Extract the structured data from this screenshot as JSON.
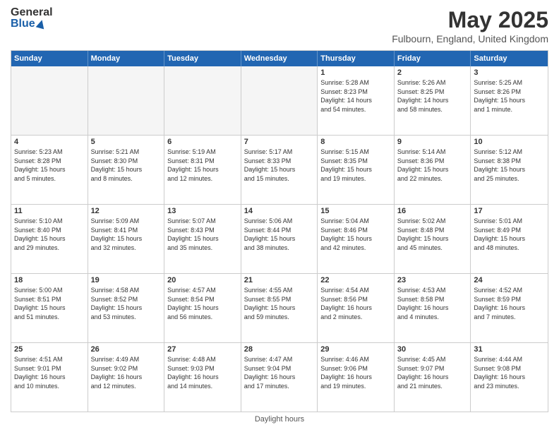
{
  "header": {
    "logo_general": "General",
    "logo_blue": "Blue",
    "title": "May 2025",
    "location": "Fulbourn, England, United Kingdom"
  },
  "days_of_week": [
    "Sunday",
    "Monday",
    "Tuesday",
    "Wednesday",
    "Thursday",
    "Friday",
    "Saturday"
  ],
  "footer": {
    "label": "Daylight hours"
  },
  "weeks": [
    {
      "cells": [
        {
          "day": "",
          "empty": true,
          "content": ""
        },
        {
          "day": "",
          "empty": true,
          "content": ""
        },
        {
          "day": "",
          "empty": true,
          "content": ""
        },
        {
          "day": "",
          "empty": true,
          "content": ""
        },
        {
          "day": "1",
          "empty": false,
          "content": "Sunrise: 5:28 AM\nSunset: 8:23 PM\nDaylight: 14 hours\nand 54 minutes."
        },
        {
          "day": "2",
          "empty": false,
          "content": "Sunrise: 5:26 AM\nSunset: 8:25 PM\nDaylight: 14 hours\nand 58 minutes."
        },
        {
          "day": "3",
          "empty": false,
          "content": "Sunrise: 5:25 AM\nSunset: 8:26 PM\nDaylight: 15 hours\nand 1 minute."
        }
      ]
    },
    {
      "cells": [
        {
          "day": "4",
          "empty": false,
          "content": "Sunrise: 5:23 AM\nSunset: 8:28 PM\nDaylight: 15 hours\nand 5 minutes."
        },
        {
          "day": "5",
          "empty": false,
          "content": "Sunrise: 5:21 AM\nSunset: 8:30 PM\nDaylight: 15 hours\nand 8 minutes."
        },
        {
          "day": "6",
          "empty": false,
          "content": "Sunrise: 5:19 AM\nSunset: 8:31 PM\nDaylight: 15 hours\nand 12 minutes."
        },
        {
          "day": "7",
          "empty": false,
          "content": "Sunrise: 5:17 AM\nSunset: 8:33 PM\nDaylight: 15 hours\nand 15 minutes."
        },
        {
          "day": "8",
          "empty": false,
          "content": "Sunrise: 5:15 AM\nSunset: 8:35 PM\nDaylight: 15 hours\nand 19 minutes."
        },
        {
          "day": "9",
          "empty": false,
          "content": "Sunrise: 5:14 AM\nSunset: 8:36 PM\nDaylight: 15 hours\nand 22 minutes."
        },
        {
          "day": "10",
          "empty": false,
          "content": "Sunrise: 5:12 AM\nSunset: 8:38 PM\nDaylight: 15 hours\nand 25 minutes."
        }
      ]
    },
    {
      "cells": [
        {
          "day": "11",
          "empty": false,
          "content": "Sunrise: 5:10 AM\nSunset: 8:40 PM\nDaylight: 15 hours\nand 29 minutes."
        },
        {
          "day": "12",
          "empty": false,
          "content": "Sunrise: 5:09 AM\nSunset: 8:41 PM\nDaylight: 15 hours\nand 32 minutes."
        },
        {
          "day": "13",
          "empty": false,
          "content": "Sunrise: 5:07 AM\nSunset: 8:43 PM\nDaylight: 15 hours\nand 35 minutes."
        },
        {
          "day": "14",
          "empty": false,
          "content": "Sunrise: 5:06 AM\nSunset: 8:44 PM\nDaylight: 15 hours\nand 38 minutes."
        },
        {
          "day": "15",
          "empty": false,
          "content": "Sunrise: 5:04 AM\nSunset: 8:46 PM\nDaylight: 15 hours\nand 42 minutes."
        },
        {
          "day": "16",
          "empty": false,
          "content": "Sunrise: 5:02 AM\nSunset: 8:48 PM\nDaylight: 15 hours\nand 45 minutes."
        },
        {
          "day": "17",
          "empty": false,
          "content": "Sunrise: 5:01 AM\nSunset: 8:49 PM\nDaylight: 15 hours\nand 48 minutes."
        }
      ]
    },
    {
      "cells": [
        {
          "day": "18",
          "empty": false,
          "content": "Sunrise: 5:00 AM\nSunset: 8:51 PM\nDaylight: 15 hours\nand 51 minutes."
        },
        {
          "day": "19",
          "empty": false,
          "content": "Sunrise: 4:58 AM\nSunset: 8:52 PM\nDaylight: 15 hours\nand 53 minutes."
        },
        {
          "day": "20",
          "empty": false,
          "content": "Sunrise: 4:57 AM\nSunset: 8:54 PM\nDaylight: 15 hours\nand 56 minutes."
        },
        {
          "day": "21",
          "empty": false,
          "content": "Sunrise: 4:55 AM\nSunset: 8:55 PM\nDaylight: 15 hours\nand 59 minutes."
        },
        {
          "day": "22",
          "empty": false,
          "content": "Sunrise: 4:54 AM\nSunset: 8:56 PM\nDaylight: 16 hours\nand 2 minutes."
        },
        {
          "day": "23",
          "empty": false,
          "content": "Sunrise: 4:53 AM\nSunset: 8:58 PM\nDaylight: 16 hours\nand 4 minutes."
        },
        {
          "day": "24",
          "empty": false,
          "content": "Sunrise: 4:52 AM\nSunset: 8:59 PM\nDaylight: 16 hours\nand 7 minutes."
        }
      ]
    },
    {
      "cells": [
        {
          "day": "25",
          "empty": false,
          "content": "Sunrise: 4:51 AM\nSunset: 9:01 PM\nDaylight: 16 hours\nand 10 minutes."
        },
        {
          "day": "26",
          "empty": false,
          "content": "Sunrise: 4:49 AM\nSunset: 9:02 PM\nDaylight: 16 hours\nand 12 minutes."
        },
        {
          "day": "27",
          "empty": false,
          "content": "Sunrise: 4:48 AM\nSunset: 9:03 PM\nDaylight: 16 hours\nand 14 minutes."
        },
        {
          "day": "28",
          "empty": false,
          "content": "Sunrise: 4:47 AM\nSunset: 9:04 PM\nDaylight: 16 hours\nand 17 minutes."
        },
        {
          "day": "29",
          "empty": false,
          "content": "Sunrise: 4:46 AM\nSunset: 9:06 PM\nDaylight: 16 hours\nand 19 minutes."
        },
        {
          "day": "30",
          "empty": false,
          "content": "Sunrise: 4:45 AM\nSunset: 9:07 PM\nDaylight: 16 hours\nand 21 minutes."
        },
        {
          "day": "31",
          "empty": false,
          "content": "Sunrise: 4:44 AM\nSunset: 9:08 PM\nDaylight: 16 hours\nand 23 minutes."
        }
      ]
    }
  ]
}
